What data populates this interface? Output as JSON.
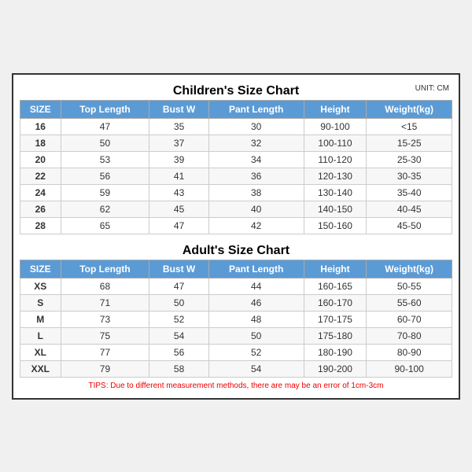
{
  "children_section": {
    "title": "Children's Size Chart",
    "unit": "UNIT: CM",
    "headers": [
      "SIZE",
      "Top Length",
      "Bust W",
      "Pant Length",
      "Height",
      "Weight(kg)"
    ],
    "rows": [
      [
        "16",
        "47",
        "35",
        "30",
        "90-100",
        "<15"
      ],
      [
        "18",
        "50",
        "37",
        "32",
        "100-110",
        "15-25"
      ],
      [
        "20",
        "53",
        "39",
        "34",
        "110-120",
        "25-30"
      ],
      [
        "22",
        "56",
        "41",
        "36",
        "120-130",
        "30-35"
      ],
      [
        "24",
        "59",
        "43",
        "38",
        "130-140",
        "35-40"
      ],
      [
        "26",
        "62",
        "45",
        "40",
        "140-150",
        "40-45"
      ],
      [
        "28",
        "65",
        "47",
        "42",
        "150-160",
        "45-50"
      ]
    ]
  },
  "adult_section": {
    "title": "Adult's Size Chart",
    "headers": [
      "SIZE",
      "Top Length",
      "Bust W",
      "Pant Length",
      "Height",
      "Weight(kg)"
    ],
    "rows": [
      [
        "XS",
        "68",
        "47",
        "44",
        "160-165",
        "50-55"
      ],
      [
        "S",
        "71",
        "50",
        "46",
        "160-170",
        "55-60"
      ],
      [
        "M",
        "73",
        "52",
        "48",
        "170-175",
        "60-70"
      ],
      [
        "L",
        "75",
        "54",
        "50",
        "175-180",
        "70-80"
      ],
      [
        "XL",
        "77",
        "56",
        "52",
        "180-190",
        "80-90"
      ],
      [
        "XXL",
        "79",
        "58",
        "54",
        "190-200",
        "90-100"
      ]
    ]
  },
  "tips": "TIPS: Due to different measurement methods, there are may be an error of 1cm-3cm"
}
